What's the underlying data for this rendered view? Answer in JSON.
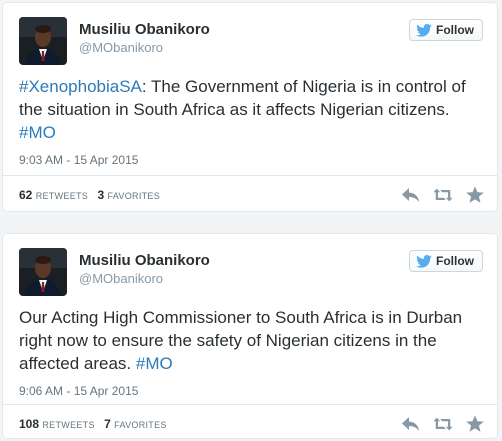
{
  "tweets": [
    {
      "display_name": "Musiliu Obanikoro",
      "screen_name": "@MObanikoro",
      "follow_label": "Follow",
      "text_parts": [
        {
          "t": "#XenophobiaSA",
          "tag": true
        },
        {
          "t": ": The Government of Nigeria is in control of the situation in South Africa as it affects Nigerian citizens. ",
          "tag": false
        },
        {
          "t": "#MO",
          "tag": true
        }
      ],
      "timestamp": "9:03 AM - 15 Apr 2015",
      "retweets_count": "62",
      "retweets_label": "RETWEETS",
      "favorites_count": "3",
      "favorites_label": "FAVORITES"
    },
    {
      "display_name": "Musiliu Obanikoro",
      "screen_name": "@MObanikoro",
      "follow_label": "Follow",
      "text_parts": [
        {
          "t": "Our Acting High Commissioner to South Africa is in Durban right now to ensure the safety of Nigerian citizens in the affected areas. ",
          "tag": false
        },
        {
          "t": "#MO",
          "tag": true
        }
      ],
      "timestamp": "9:06 AM - 15 Apr 2015",
      "retweets_count": "108",
      "retweets_label": "RETWEETS",
      "favorites_count": "7",
      "favorites_label": "FAVORITES"
    }
  ],
  "icons": {
    "follow": "twitter-bird-icon",
    "reply": "reply-icon",
    "retweet": "retweet-icon",
    "favorite": "star-icon"
  },
  "colors": {
    "hashtag": "#2b7bb9",
    "twitter_blue": "#55acee",
    "action_gray": "#8899a6"
  }
}
